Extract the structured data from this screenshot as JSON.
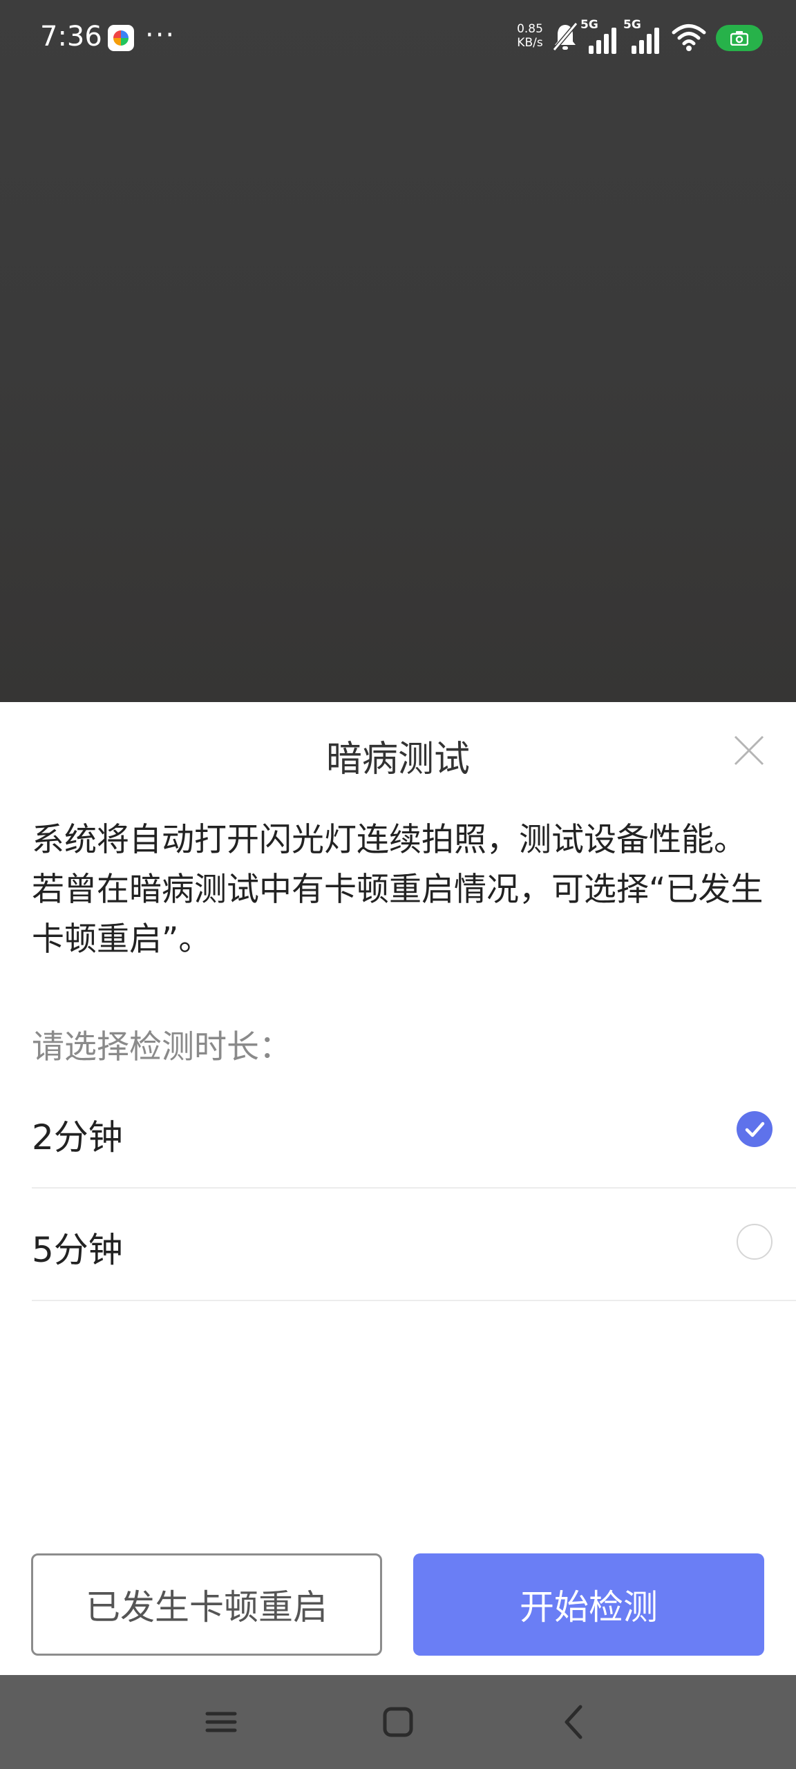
{
  "status_bar": {
    "time": "7:36",
    "more": "···",
    "net_speed_value": "0.85",
    "net_speed_unit": "KB/s",
    "signal_1": "5G",
    "signal_2": "5G"
  },
  "dialog": {
    "title": "暗病测试",
    "description": "系统将自动打开闪光灯连续拍照，测试设备性能。若曾在暗病测试中有卡顿重启情况，可选择“已发生卡顿重启”。",
    "duration_prompt": "请选择检测时长：",
    "options": [
      {
        "label": "2分钟",
        "selected": true
      },
      {
        "label": "5分钟",
        "selected": false
      }
    ],
    "secondary_button": "已发生卡顿重启",
    "primary_button": "开始检测"
  },
  "colors": {
    "accent": "#6a7ef5",
    "radio_checked": "#5e72eb",
    "battery": "#27b24a"
  },
  "icons": [
    "app-icon",
    "bell-muted-icon",
    "signal-icon",
    "wifi-icon",
    "battery-icon",
    "close-icon",
    "check-icon",
    "menu-icon",
    "home-icon",
    "back-icon"
  ]
}
